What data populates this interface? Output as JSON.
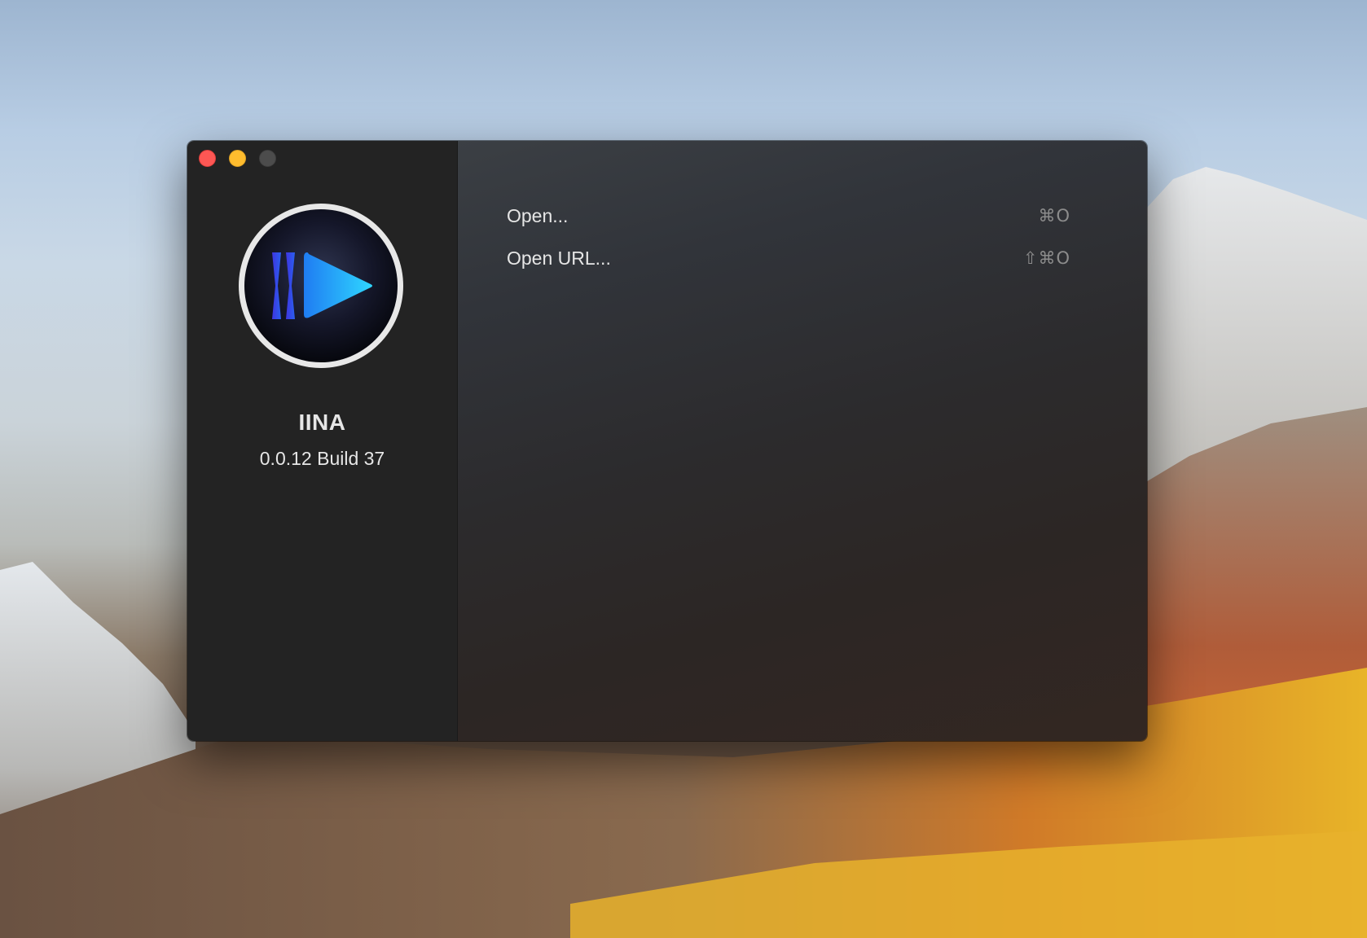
{
  "window": {
    "traffic_lights": [
      "close",
      "minimize",
      "zoom"
    ],
    "colors": {
      "close": "#fd5754",
      "minimize": "#febc2e",
      "zoom": "#4c4c4c"
    }
  },
  "sidebar": {
    "app_icon": "iina-play-logo-icon",
    "app_name": "IINA",
    "version": "0.0.12 Build 37"
  },
  "main": {
    "items": [
      {
        "label": "Open...",
        "shortcut": "⌘O"
      },
      {
        "label": "Open URL...",
        "shortcut": "⇧⌘O"
      }
    ]
  },
  "theme": {
    "accent": "#2aa8ff",
    "text": "#e6e6e6",
    "shortcut_text": "#8c8c8c",
    "sidebar_bg": "#232323"
  }
}
